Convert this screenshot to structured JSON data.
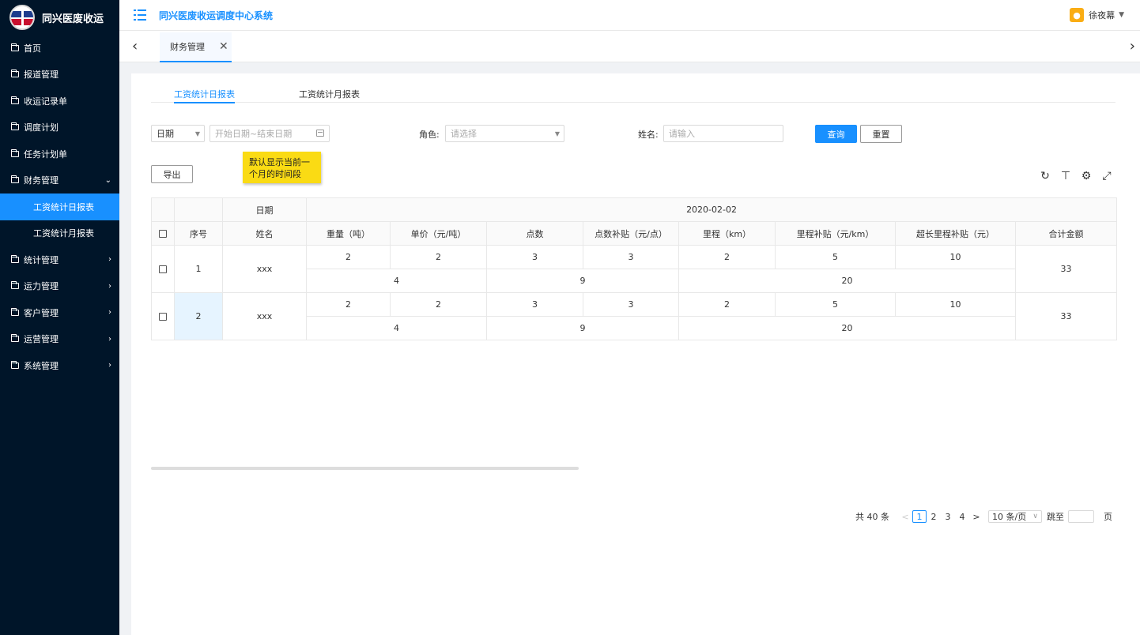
{
  "brand": {
    "name": "同兴医废收运"
  },
  "header": {
    "title": "同兴医废收运调度中心系统",
    "user": "徐夜幕",
    "avatar_char": "👤"
  },
  "sidebar": {
    "items": [
      {
        "label": "首页"
      },
      {
        "label": "报道管理"
      },
      {
        "label": "收运记录单"
      },
      {
        "label": "调度计划"
      },
      {
        "label": "任务计划单"
      },
      {
        "label": "财务管理",
        "arrow": "⌄"
      },
      {
        "label": "工资统计日报表"
      },
      {
        "label": "工资统计月报表"
      },
      {
        "label": "统计管理",
        "arrow": "›"
      },
      {
        "label": "运力管理",
        "arrow": "›"
      },
      {
        "label": "客户管理",
        "arrow": "›"
      },
      {
        "label": "运营管理",
        "arrow": "›"
      },
      {
        "label": "系统管理",
        "arrow": "›"
      }
    ]
  },
  "tabbar": {
    "tab_label": "财务管理",
    "close": "✕",
    "prev": "‹",
    "next": "›"
  },
  "subtabs": {
    "daily": "工资统计日报表",
    "monthly": "工资统计月报表"
  },
  "filters": {
    "date_type": "日期",
    "date_range_placeholder": "开始日期~结束日期",
    "role_label": "角色:",
    "role_placeholder": "请选择",
    "name_label": "姓名:",
    "name_placeholder": "请输入",
    "query": "查询",
    "reset": "重置",
    "export": "导出"
  },
  "note": {
    "text": "默认显示当前一个月的时间段"
  },
  "table": {
    "date_header": "日期",
    "date_value": "2020-02-02",
    "cols": {
      "index": "序号",
      "name": "姓名",
      "weight": "重量（吨）",
      "unit_price": "单价（元/吨）",
      "points": "点数",
      "point_subsidy": "点数补贴（元/点）",
      "mileage": "里程（km）",
      "mileage_subsidy": "里程补贴（元/km）",
      "long_subsidy": "超长里程补贴（元）",
      "total": "合计金额"
    },
    "rows": [
      {
        "index": "1",
        "name": "xxx",
        "weight": "2",
        "unit_price": "2",
        "points": "3",
        "point_subsidy": "3",
        "mileage": "2",
        "mileage_subsidy": "5",
        "long_subsidy": "10",
        "sub1": "4",
        "sub2": "9",
        "sub3": "20",
        "total": "33"
      },
      {
        "index": "2",
        "name": "xxx",
        "weight": "2",
        "unit_price": "2",
        "points": "3",
        "point_subsidy": "3",
        "mileage": "2",
        "mileage_subsidy": "5",
        "long_subsidy": "10",
        "sub1": "4",
        "sub2": "9",
        "sub3": "20",
        "total": "33"
      }
    ]
  },
  "pagination": {
    "total": "共 40 条",
    "prev": "<",
    "pages": [
      "1",
      "2",
      "3",
      "4"
    ],
    "next": ">",
    "size": "10 条/页",
    "size_caret": "∨",
    "jump": "跳至",
    "page_unit": "页"
  }
}
